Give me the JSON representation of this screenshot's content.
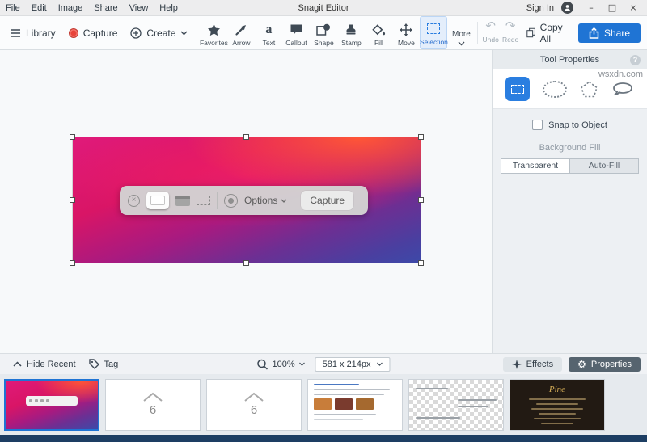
{
  "titlebar": {
    "menu": [
      {
        "label": "File"
      },
      {
        "label": "Edit"
      },
      {
        "label": "Image"
      },
      {
        "label": "Share"
      },
      {
        "label": "View"
      },
      {
        "label": "Help"
      }
    ],
    "title": "Snagit Editor",
    "sign_in_label": "Sign In",
    "window_controls": {
      "minimize": "–",
      "maximize": "□",
      "close": "×"
    }
  },
  "watermark_text": "wsxdn.com",
  "icons": {
    "undo_glyph": "↶",
    "redo_glyph": "↷",
    "gear_glyph": "⚙",
    "close_x_glyph": "×",
    "text_tool_glyph": "a"
  },
  "toolbar": {
    "library_label": "Library",
    "capture_label": "Capture",
    "create_label": "Create",
    "tools": [
      {
        "label": "Favorites"
      },
      {
        "label": "Arrow"
      },
      {
        "label": "Text"
      },
      {
        "label": "Callout"
      },
      {
        "label": "Shape"
      },
      {
        "label": "Stamp"
      },
      {
        "label": "Fill"
      },
      {
        "label": "Move"
      },
      {
        "label": "Selection",
        "selected": true
      }
    ],
    "more_label": "More",
    "undo_label": "Undo",
    "redo_label": "Redo",
    "copy_all_label": "Copy All",
    "share_label": "Share"
  },
  "canvas": {
    "capture_toolbar": {
      "options_label": "Options",
      "capture_label": "Capture"
    }
  },
  "tool_properties": {
    "title": "Tool Properties",
    "help_label": "?",
    "snap_label": "Snap to Object",
    "background_fill_label": "Background Fill",
    "fill_options": [
      {
        "label": "Transparent",
        "selected": true
      },
      {
        "label": "Auto-Fill",
        "selected": false
      }
    ]
  },
  "statusbar": {
    "hide_recent_label": "Hide Recent",
    "tag_label": "Tag",
    "zoom_value": "100%",
    "dimensions_value": "581 x 214px",
    "effects_label": "Effects",
    "properties_label": "Properties"
  },
  "tray": {
    "thumbnails": [
      {
        "kind": "gradient-capture",
        "selected": true
      },
      {
        "kind": "shortcut-key",
        "text": "6"
      },
      {
        "kind": "shortcut-key",
        "text": "6"
      },
      {
        "kind": "webpage"
      },
      {
        "kind": "transparent-image"
      },
      {
        "kind": "menu-card",
        "title": "Pine"
      }
    ]
  },
  "colors": {
    "accent_blue": "#2a7ee0",
    "share_blue": "#1f74d4",
    "capture_red": "#e8443a",
    "bottom_strip": "#1d3e63"
  }
}
